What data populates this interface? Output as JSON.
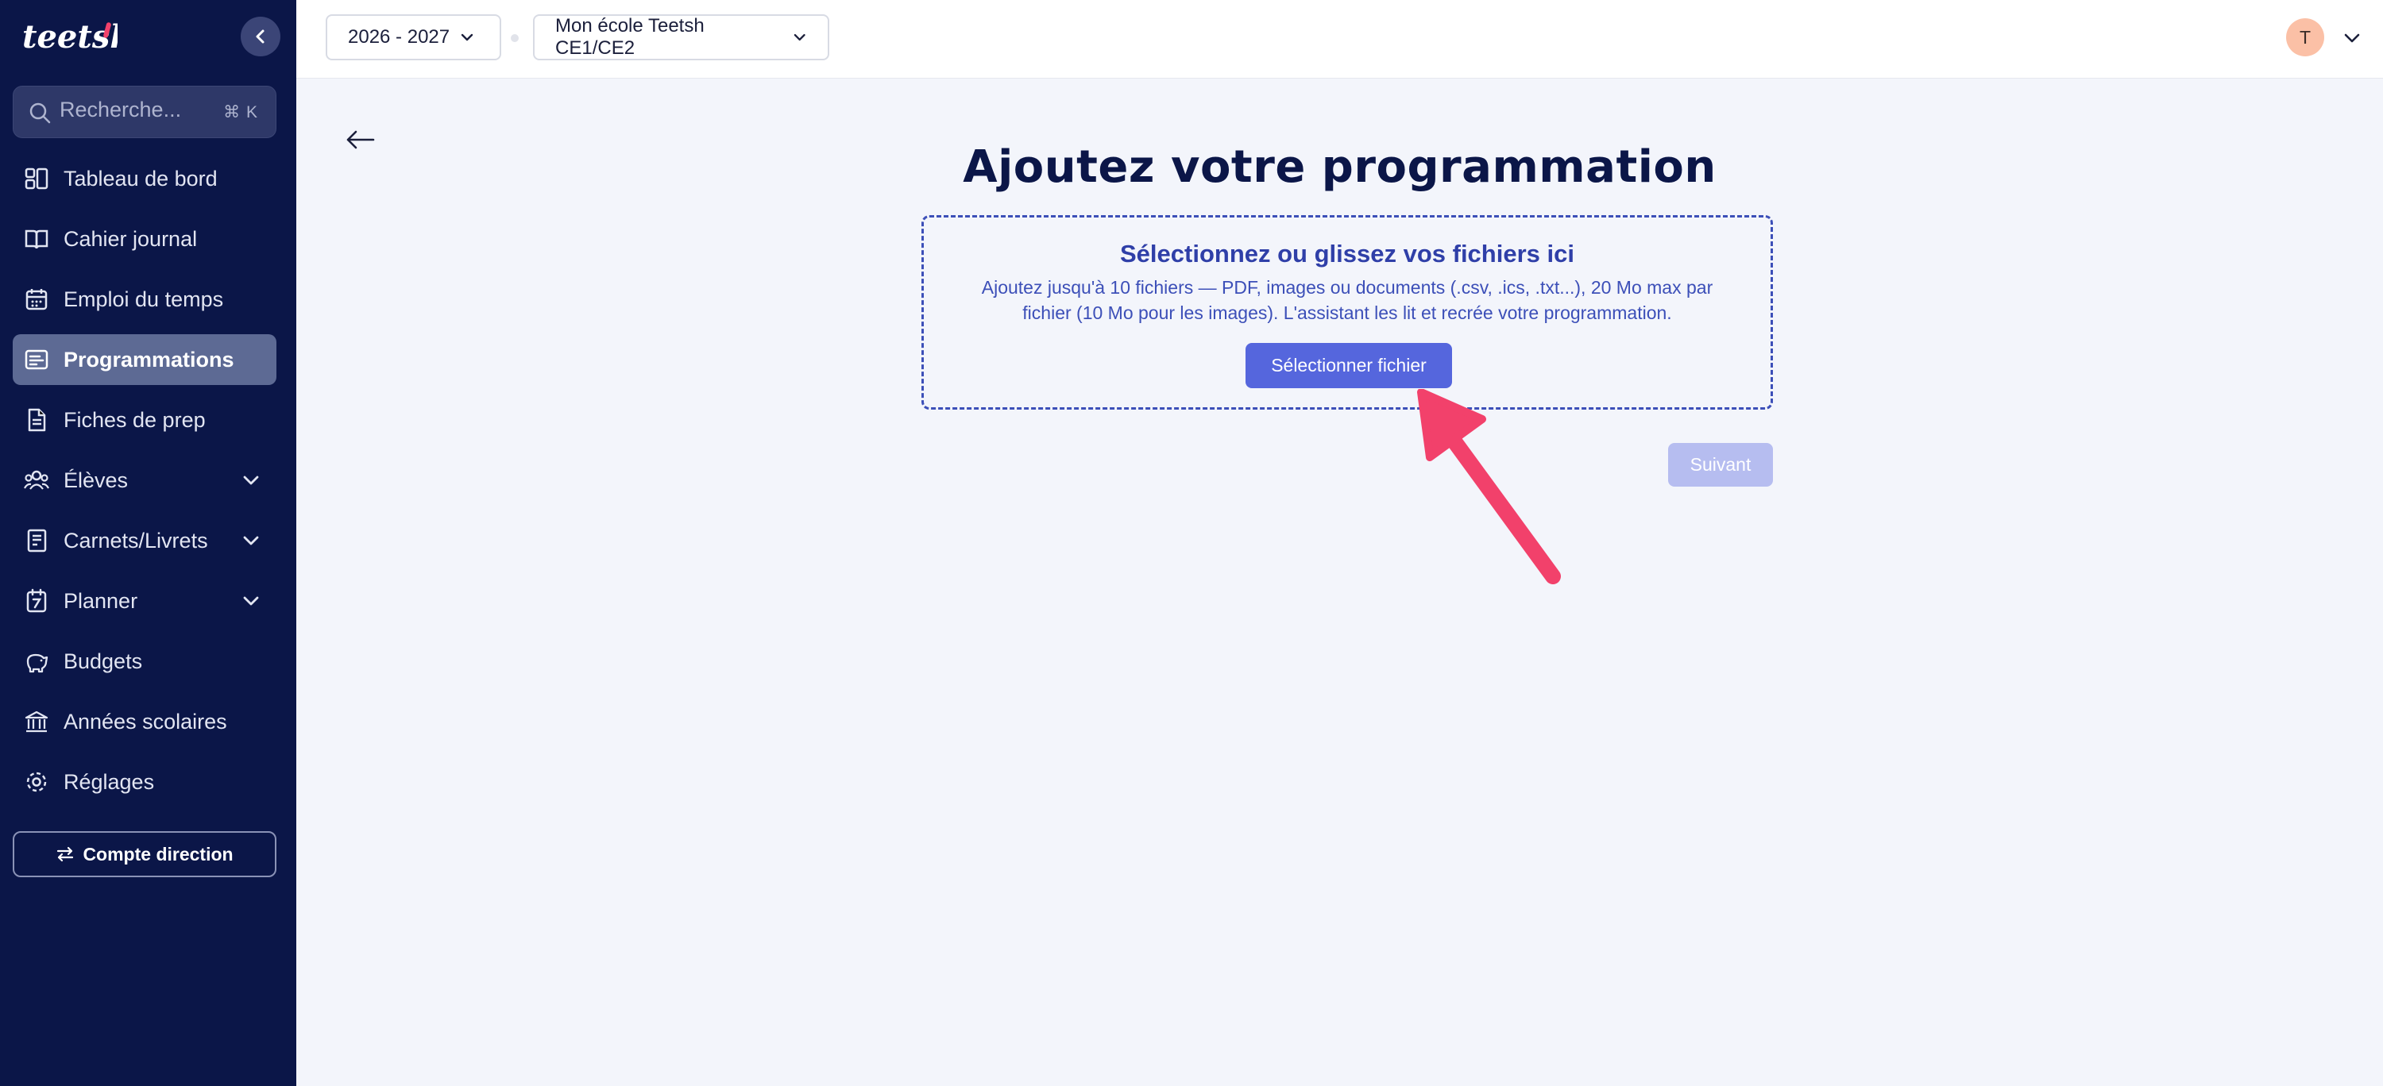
{
  "app": {
    "logo_text": "teetsh"
  },
  "sidebar": {
    "search": {
      "placeholder": "Recherche...",
      "shortcut": "⌘ K"
    },
    "items": [
      {
        "label": "Tableau de bord",
        "icon": "dashboard-icon"
      },
      {
        "label": "Cahier journal",
        "icon": "book-icon"
      },
      {
        "label": "Emploi du temps",
        "icon": "calendar-icon"
      },
      {
        "label": "Programmations",
        "icon": "programmations-icon",
        "active": true
      },
      {
        "label": "Fiches de prep",
        "icon": "document-icon"
      },
      {
        "label": "Élèves",
        "icon": "students-icon",
        "expandable": true
      },
      {
        "label": "Carnets/Livrets",
        "icon": "notebook-icon",
        "expandable": true
      },
      {
        "label": "Planner",
        "icon": "planner-icon",
        "expandable": true
      },
      {
        "label": "Budgets",
        "icon": "piggy-bank-icon"
      },
      {
        "label": "Années scolaires",
        "icon": "school-icon"
      },
      {
        "label": "Réglages",
        "icon": "gear-icon"
      }
    ],
    "account_button": "Compte direction"
  },
  "topbar": {
    "year_select": "2026 - 2027",
    "school_select": "Mon école Teetsh CE1/CE2",
    "avatar_initial": "T"
  },
  "main": {
    "title": "Ajoutez votre programmation",
    "dropzone": {
      "title": "Sélectionnez ou glissez vos fichiers ici",
      "description": "Ajoutez jusqu'à 10 fichiers — PDF, images ou documents (.csv, .ics, .txt...), 20 Mo max par fichier (10 Mo pour les images). L'assistant les lit et recrée votre programmation.",
      "button": "Sélectionner fichier"
    },
    "next_button": "Suivant"
  },
  "colors": {
    "sidebar_bg": "#0b1648",
    "accent": "#5566dd",
    "annotation_arrow": "#f2416b"
  }
}
